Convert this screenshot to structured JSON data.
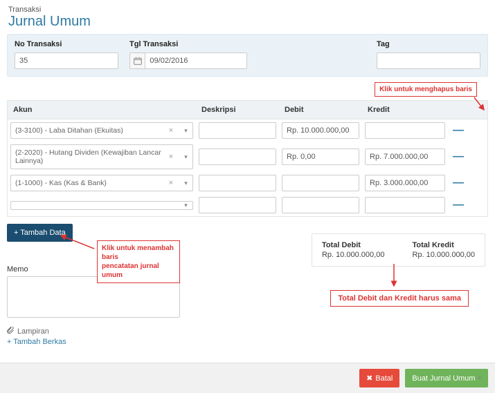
{
  "breadcrumb": "Transaksi",
  "title": "Jurnal Umum",
  "header": {
    "no_label": "No Transaksi",
    "no_value": "35",
    "tgl_label": "Tgl Transaksi",
    "tgl_value": "09/02/2016",
    "tag_label": "Tag",
    "tag_value": ""
  },
  "callouts": {
    "delete_row": "Klik untuk menghapus baris",
    "add_row_l1": "Klik untuk menambah baris",
    "add_row_l2": "pencatatan jurnal umum",
    "totals_match": "Total Debit dan Kredit harus sama"
  },
  "grid": {
    "head": {
      "akun": "Akun",
      "desk": "Deskripsi",
      "debit": "Debit",
      "kredit": "Kredit"
    },
    "rows": [
      {
        "akun": "(3-3100) - Laba Ditahan (Ekuitas)",
        "desk": "",
        "debit": "Rp. 10.000.000,00",
        "kredit": ""
      },
      {
        "akun": "(2-2020) - Hutang Dividen (Kewajiban Lancar Lainnya)",
        "desk": "",
        "debit": "Rp. 0,00",
        "kredit": "Rp. 7.000.000,00"
      },
      {
        "akun": "(1-1000) - Kas (Kas & Bank)",
        "desk": "",
        "debit": "",
        "kredit": "Rp. 3.000.000,00"
      },
      {
        "akun": "",
        "desk": "",
        "debit": "",
        "kredit": ""
      }
    ]
  },
  "add_button": "+ Tambah Data",
  "memo": {
    "label": "Memo",
    "value": ""
  },
  "attachment": {
    "label": "Lampiran",
    "add_link": "+ Tambah Berkas"
  },
  "totals": {
    "debit_label": "Total Debit",
    "debit_value": "Rp. 10.000.000,00",
    "kredit_label": "Total Kredit",
    "kredit_value": "Rp. 10.000.000,00"
  },
  "footer": {
    "cancel": "Batal",
    "submit": "Buat Jurnal Umum"
  }
}
